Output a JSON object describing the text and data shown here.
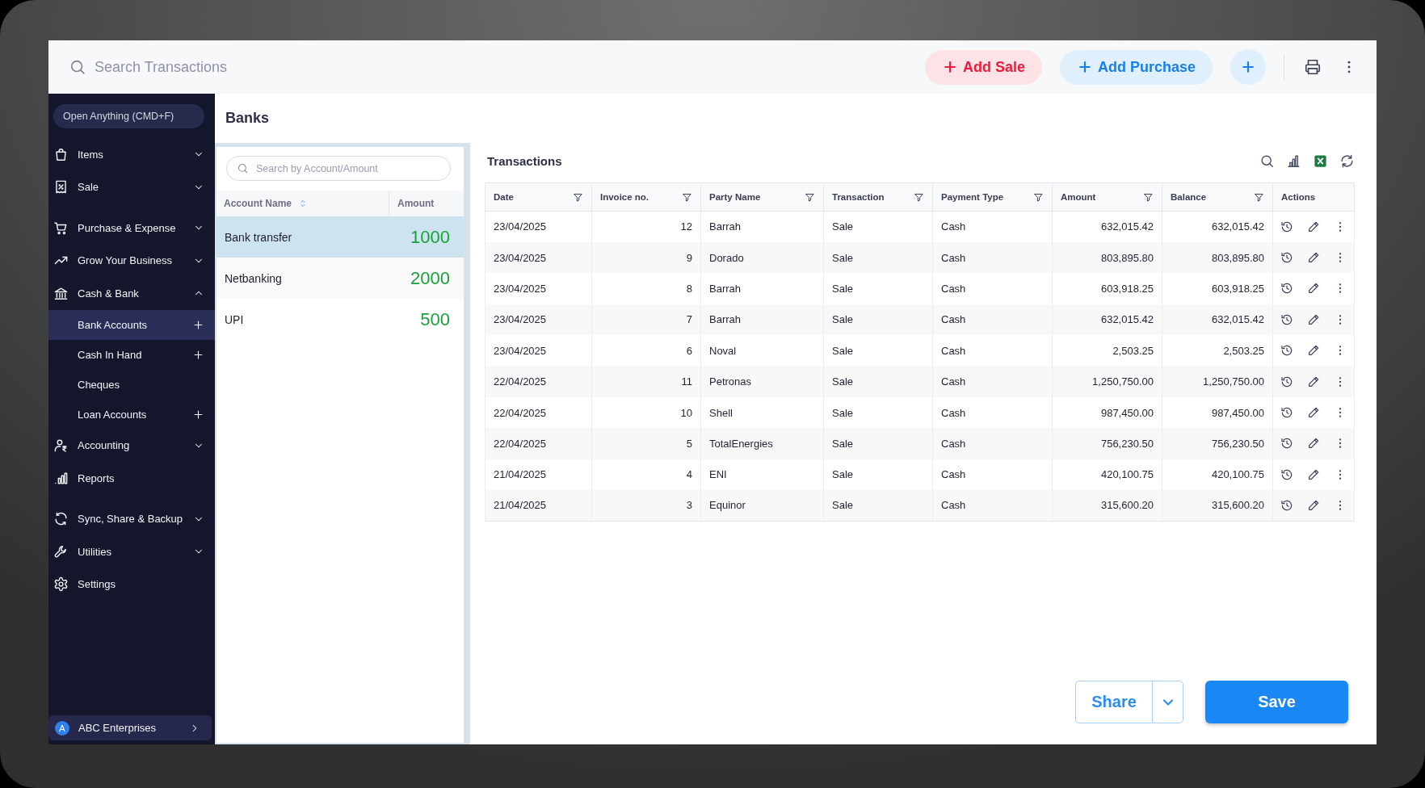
{
  "top_bar": {
    "search": {
      "placeholder": "Search Transactions"
    },
    "buttons": [
      {
        "kind": "sale",
        "label": "Add Sale"
      },
      {
        "kind": "purchase",
        "label": "Add Purchase"
      }
    ]
  },
  "sidebar": {
    "quick_open": "Open Anything (CMD+F)",
    "sections": [
      {
        "items": [
          {
            "label": "Items",
            "kind": "group",
            "expanded": false,
            "selected": false
          },
          {
            "label": "Sale",
            "kind": "group",
            "expanded": false,
            "selected": false
          }
        ]
      },
      {
        "items": [
          {
            "label": "Purchase & Expense",
            "kind": "group",
            "expanded": false,
            "selected": false
          },
          {
            "label": "Grow Your Business",
            "kind": "group",
            "expanded": false,
            "selected": false
          },
          {
            "label": "Cash & Bank",
            "kind": "group",
            "expanded": true,
            "selected": false,
            "children": [
              {
                "label": "Bank Accounts",
                "selected": true,
                "add": true
              },
              {
                "label": "Cash In Hand",
                "selected": false,
                "add": true
              },
              {
                "label": "Cheques",
                "selected": false,
                "add": false
              },
              {
                "label": "Loan Accounts",
                "selected": false,
                "add": true
              }
            ]
          },
          {
            "label": "Accounting",
            "kind": "group",
            "expanded": false,
            "selected": false
          },
          {
            "label": "Reports",
            "kind": "link",
            "selected": false
          }
        ]
      },
      {
        "items": [
          {
            "label": "Sync, Share & Backup",
            "kind": "group",
            "expanded": false,
            "selected": false
          },
          {
            "label": "Utilities",
            "kind": "group",
            "expanded": false,
            "selected": false
          },
          {
            "label": "Settings",
            "kind": "link",
            "selected": false
          }
        ]
      }
    ],
    "company": {
      "initial": "A",
      "name": "ABC Enterprises"
    }
  },
  "banks": {
    "title": "Banks",
    "search": {
      "placeholder": "Search by Account/Amount"
    },
    "columns": [
      {
        "label": "Account Name",
        "sortable": true
      },
      {
        "label": "Amount",
        "sortable": false
      }
    ],
    "accounts": [
      {
        "name": "Bank transfer",
        "amount": "1000",
        "selected": true
      },
      {
        "name": "Netbanking",
        "amount": "2000",
        "selected": false
      },
      {
        "name": "UPI",
        "amount": "500",
        "selected": false
      }
    ]
  },
  "transactions": {
    "title": "Transactions",
    "columns": [
      {
        "label": "Date",
        "kind": "text",
        "filter": true
      },
      {
        "label": "Invoice no.",
        "kind": "number",
        "filter": true
      },
      {
        "label": "Party Name",
        "kind": "text",
        "filter": true
      },
      {
        "label": "Transaction",
        "kind": "text",
        "filter": true
      },
      {
        "label": "Payment Type",
        "kind": "text",
        "filter": true
      },
      {
        "label": "Amount",
        "kind": "number",
        "filter": true
      },
      {
        "label": "Balance",
        "kind": "number",
        "filter": true
      },
      {
        "label": "Actions",
        "kind": "actions",
        "filter": false
      }
    ],
    "rows": [
      [
        "23/04/2025",
        "12",
        "Barrah",
        "Sale",
        "Cash",
        "632,015.42",
        "632,015.42"
      ],
      [
        "23/04/2025",
        "9",
        "Dorado",
        "Sale",
        "Cash",
        "803,895.80",
        "803,895.80"
      ],
      [
        "23/04/2025",
        "8",
        "Barrah",
        "Sale",
        "Cash",
        "603,918.25",
        "603,918.25"
      ],
      [
        "23/04/2025",
        "7",
        "Barrah",
        "Sale",
        "Cash",
        "632,015.42",
        "632,015.42"
      ],
      [
        "23/04/2025",
        "6",
        "Noval",
        "Sale",
        "Cash",
        "2,503.25",
        "2,503.25"
      ],
      [
        "22/04/2025",
        "11",
        "Petronas",
        "Sale",
        "Cash",
        "1,250,750.00",
        "1,250,750.00"
      ],
      [
        "22/04/2025",
        "10",
        "Shell",
        "Sale",
        "Cash",
        "987,450.00",
        "987,450.00"
      ],
      [
        "22/04/2025",
        "5",
        "TotalEnergies",
        "Sale",
        "Cash",
        "756,230.50",
        "756,230.50"
      ],
      [
        "21/04/2025",
        "4",
        "ENI",
        "Sale",
        "Cash",
        "420,100.75",
        "420,100.75"
      ],
      [
        "21/04/2025",
        "3",
        "Equinor",
        "Sale",
        "Cash",
        "315,600.20",
        "315,600.20"
      ]
    ]
  },
  "footer": {
    "buttons": [
      {
        "kind": "share",
        "label": "Share"
      },
      {
        "kind": "save",
        "label": "Save"
      }
    ]
  }
}
